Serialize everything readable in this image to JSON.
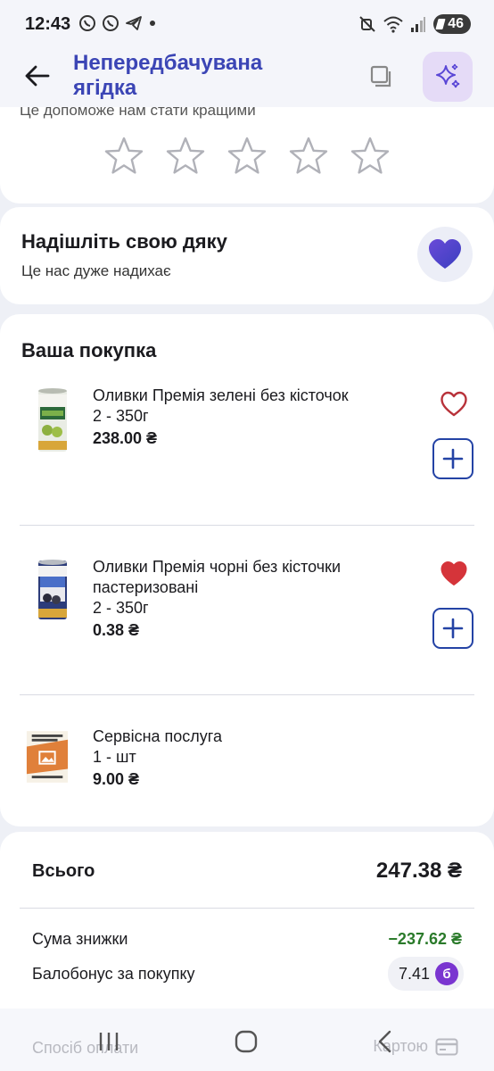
{
  "status_bar": {
    "time": "12:43",
    "battery": "46"
  },
  "header": {
    "title": "Непередбачувана ягідка"
  },
  "rating": {
    "hint_text": "Це допоможе нам стати кращими",
    "stars_count": 5
  },
  "thanks": {
    "title": "Надішліть свою дяку",
    "subtitle": "Це нас дуже надихає"
  },
  "purchase": {
    "title": "Ваша покупка",
    "items": [
      {
        "name": "Оливки Премія зелені без кісточок",
        "qty": "2 - 350г",
        "price": "238.00 ₴",
        "favorite": false
      },
      {
        "name": "Оливки Премія чорні без кісточки пастеризовані",
        "qty": "2 - 350г",
        "price": "0.38 ₴",
        "favorite": true
      },
      {
        "name": "Сервісна послуга",
        "qty": "1 - шт",
        "price": "9.00 ₴"
      }
    ]
  },
  "totals": {
    "total_label": "Всього",
    "total_value": "247.38 ₴",
    "discount_label": "Сума знижки",
    "discount_value": "−237.62 ₴",
    "bonus_label": "Балобонус за покупку",
    "bonus_value": "7.41",
    "bonus_badge": "б"
  },
  "payment": {
    "method_label": "Спосіб оплати",
    "method_value": "Картою"
  },
  "colors": {
    "accent": "#3b45b5",
    "heart_purple": "#5a3fc6",
    "favorite_red": "#d5343a",
    "discount_green": "#2a7a2a",
    "bonus_purple": "#7a35d0"
  }
}
